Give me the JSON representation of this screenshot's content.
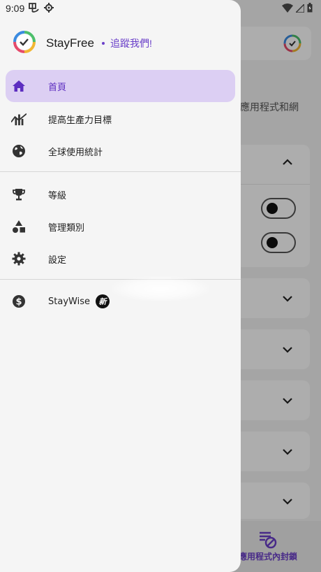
{
  "status_bar": {
    "time": "9:09"
  },
  "drawer": {
    "app_name": "StayFree",
    "follow_link": "追蹤我們!",
    "nav": [
      {
        "label": "首頁",
        "icon": "home-icon",
        "active": true
      },
      {
        "label": "提高生產力目標",
        "icon": "productivity-chart-icon",
        "active": false
      },
      {
        "label": "全球使用統計",
        "icon": "globe-icon",
        "active": false
      },
      {
        "label": "等級",
        "icon": "trophy-icon",
        "active": false
      },
      {
        "label": "管理類別",
        "icon": "categories-icon",
        "active": false
      },
      {
        "label": "設定",
        "icon": "gear-icon",
        "active": false
      },
      {
        "label": "StayWise",
        "icon": "dollar-circle-icon",
        "active": false,
        "badge": "新"
      }
    ]
  },
  "background": {
    "description_fragment": "交應用程式和網",
    "bottom_nav_label": "應用程式內封鎖"
  },
  "colors": {
    "accent": "#6a3fc9",
    "active_bg": "#dccff3",
    "drawer_bg": "#f5f5f5"
  }
}
